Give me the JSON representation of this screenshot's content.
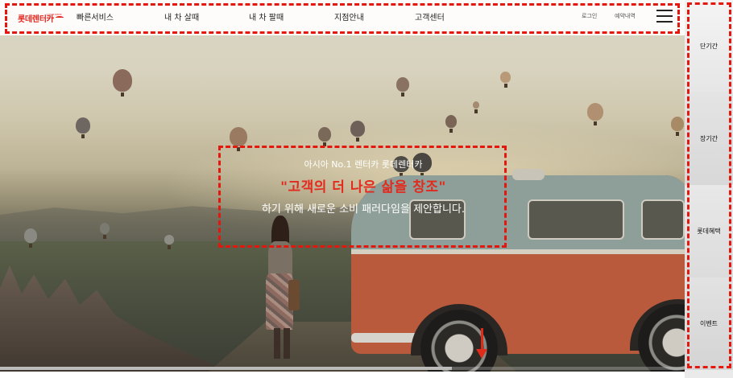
{
  "brand": {
    "logo_text": "롯데렌터카",
    "logo_tagline": "LOTTE RENT-A-CAR",
    "accent_color": "#e3261f"
  },
  "nav": {
    "items": [
      {
        "label": "빠른서비스"
      },
      {
        "label": "내 차 살때"
      },
      {
        "label": "내 차 팔때"
      },
      {
        "label": "지점안내"
      },
      {
        "label": "고객센터"
      }
    ],
    "login": "로그인",
    "reservations": "예약내역",
    "menu_icon": "hamburger-menu-icon"
  },
  "hero": {
    "line1": "아시아 No.1 렌터카 롯데렌터카",
    "line2": "\"고객의 더 나은 삶을 창조\"",
    "line3": "하기 위해 새로운 소비 패러다임을 제안합니다.",
    "headline_color": "#e32a1d",
    "scroll_icon": "arrow-down-icon",
    "scroll_progress": 0.66
  },
  "sidebar": {
    "tiles": [
      {
        "label": "단기간"
      },
      {
        "label": "장기간"
      },
      {
        "label": "롯데혜택"
      },
      {
        "label": "이벤트"
      }
    ]
  }
}
